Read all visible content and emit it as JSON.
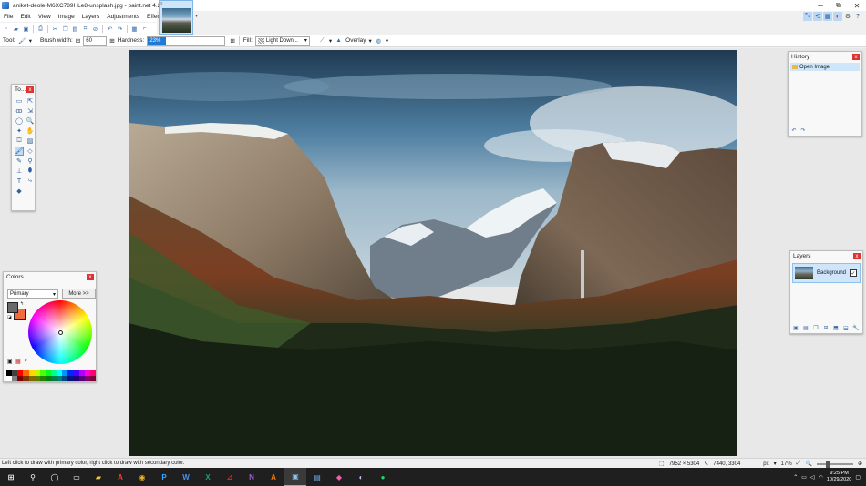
{
  "window": {
    "title": "aniket-deole-M6XC789HLe8-unsplash.jpg - paint.net 4.2.14",
    "minimize": "─",
    "maximize": "⧉",
    "close": "✕"
  },
  "menu": [
    "File",
    "Edit",
    "View",
    "Image",
    "Layers",
    "Adjustments",
    "Effects"
  ],
  "toolbar": {
    "tool_label": "Tool:",
    "brush_width_label": "Brush width:",
    "brush_width_value": "60",
    "hardness_label": "Hardness:",
    "hardness_value": "23%",
    "hardness_fraction": 0.23,
    "fill_label": "Fill:",
    "fill_value": "Light Down...",
    "blend_mode": "Overlay"
  },
  "tools_panel": {
    "title": "To..."
  },
  "colors_panel": {
    "title": "Colors",
    "selector": "Primary",
    "more_button": "More >>",
    "primary_color": "#6a6a6a",
    "secondary_color": "#f06b3e"
  },
  "history_panel": {
    "title": "History",
    "items": [
      "Open Image"
    ]
  },
  "layers_panel": {
    "title": "Layers",
    "layers": [
      {
        "name": "Background",
        "visible": true
      }
    ]
  },
  "status": {
    "hint": "Left click to draw with primary color, right click to draw with secondary color.",
    "image_size": "7952 × 5304",
    "cursor_pos": "7440, 3304",
    "units": "px",
    "zoom": "17%"
  },
  "taskbar": {
    "time": "9:25 PM",
    "date": "10/29/2020"
  },
  "close_glyph": "x"
}
